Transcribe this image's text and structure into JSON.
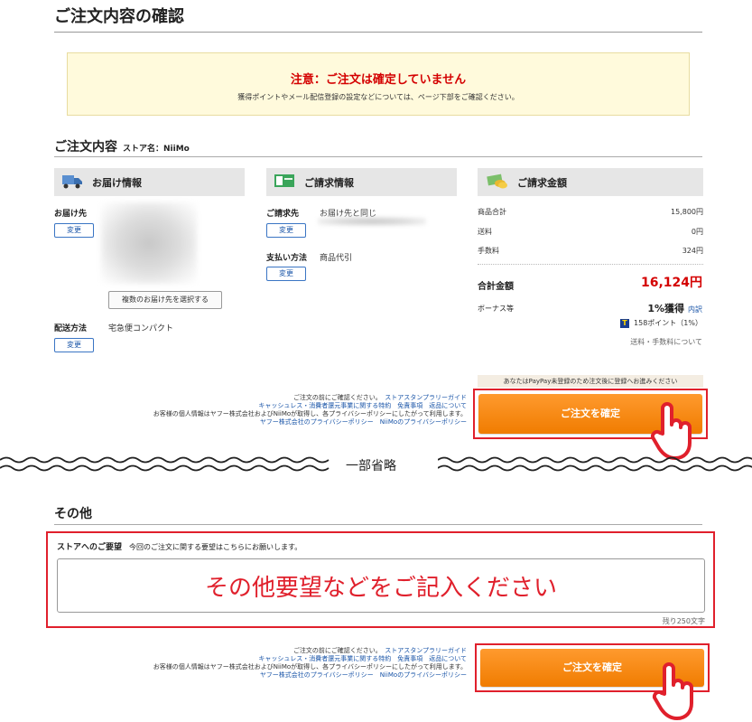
{
  "page_title": "ご注文内容の確認",
  "notice": {
    "title": "注意：ご注文は確定していません",
    "body": "獲得ポイントやメール配信登録の設定などについては、ページ下部をご確認ください。"
  },
  "order_section": {
    "title": "ご注文内容",
    "store_label": "ストア名：NiiMo"
  },
  "delivery": {
    "heading": "お届け情報",
    "address_label": "お届け先",
    "change_label": "変更",
    "multi_button": "複数のお届け先を選択する",
    "method_label": "配送方法",
    "method_value": "宅急便コンパクト",
    "method_change": "変更"
  },
  "billing": {
    "heading": "ご請求情報",
    "billing_label": "ご請求先",
    "billing_value": "お届け先と同じ",
    "change_label": "変更",
    "payment_label": "支払い方法",
    "payment_value": "商品代引",
    "payment_change": "変更"
  },
  "amount": {
    "heading": "ご請求金額",
    "rows": [
      {
        "label": "商品合計",
        "value": "15,800円"
      },
      {
        "label": "送料",
        "value": "0円"
      },
      {
        "label": "手数料",
        "value": "324円"
      }
    ],
    "total_label": "合計金額",
    "total_value": "16,124円",
    "bonus_label": "ボーナス等",
    "bonus_value": "1%獲得",
    "bonus_link": "内訳",
    "tpoint_badge": "T",
    "tpoint_value": "158ポイント（1%）",
    "shipping_link": "送料・手数料について"
  },
  "paypay_notice": "あなたはPayPay未登録のため注文後に登録へお進みください",
  "confirm_button": "ご注文を確定",
  "legal": {
    "line1_text": "ご注文の前にご確認ください。",
    "line1_link": "ストアスタンプラリーガイド",
    "line2_links": [
      "キャッシュレス・消費者還元事業に関する特約",
      "免責事項",
      "返品について"
    ],
    "line3_text": "お客様の個人情報はヤフー株式会社およびNiiMoが取得し、各プライバシーポリシーにしたがって利用します。",
    "line4_links": [
      "ヤフー株式会社のプライバシーポリシー",
      "NiiMoのプライバシーポリシー"
    ]
  },
  "omission": "一部省略",
  "other_section": {
    "title": "その他",
    "request_label": "ストアへのご要望",
    "request_hint": "今回のご注文に関する要望はこちらにお願いします。",
    "textarea_value": "その他要望などをご記入ください",
    "char_count": "残り250文字"
  },
  "colors": {
    "accent_red": "#e0202c",
    "price_red": "#d40000",
    "button_orange": "#f48a10",
    "link_blue": "#1a55a8"
  },
  "icons": [
    "truck-icon",
    "card-icon",
    "coins-icon",
    "hand-pointer-icon",
    "t-point-icon"
  ]
}
